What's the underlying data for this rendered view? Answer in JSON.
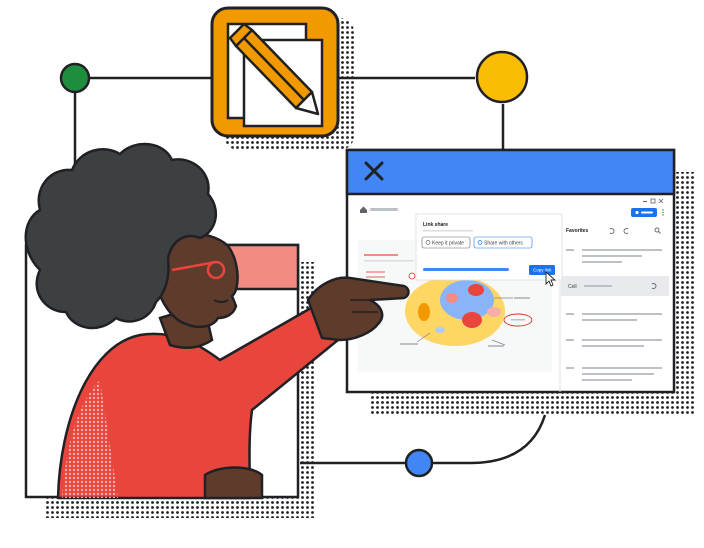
{
  "app": {
    "icon": "pencil-notes-app-icon",
    "colors": {
      "app_icon_bg": "#f29900",
      "titlebar": "#4285f4",
      "node_green": "#1e8e3e",
      "node_yellow": "#fbbc04",
      "node_blue": "#4285f4",
      "shirt": "#e8453c",
      "skin": "#5f3b2c",
      "hair": "#3c4043",
      "glasses": "#e8453c"
    }
  },
  "window": {
    "close_icon": "close-icon",
    "titlebar_color": "#4285f4"
  },
  "browser": {
    "home_icon": "home-icon",
    "share_button_icon": "share-icon"
  },
  "share_dialog": {
    "title": "Link share",
    "option_1": "Keep it private",
    "option_2": "Share with others",
    "copy_button": "Copy link"
  },
  "side_panel": {
    "header": "Favorites",
    "undo_icon": "undo-icon",
    "redo_icon": "redo-icon",
    "search_icon": "search-icon",
    "selected_label": "Cell",
    "selected_icon": "refresh-icon"
  },
  "canvas": {
    "image": "annotated-cell-diagram"
  }
}
